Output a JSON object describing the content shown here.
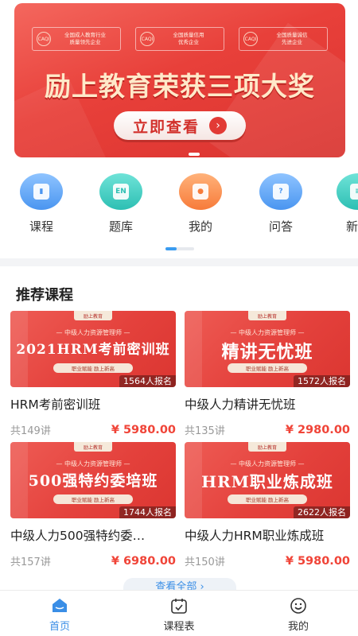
{
  "banner": {
    "awards": [
      {
        "seal": "CAQI",
        "line1": "全国成人教育行业",
        "line2": "质量领先企业"
      },
      {
        "seal": "CAQI",
        "line1": "全国质量信用",
        "line2": "优秀企业"
      },
      {
        "seal": "CAQI",
        "line1": "全国质量诚信",
        "line2": "先进企业"
      }
    ],
    "headline": "励上教育荣获三项大奖",
    "cta_label": "立即查看",
    "cta_arrow": "›"
  },
  "shortcuts": [
    {
      "label": "课程",
      "icon": "book-icon",
      "glyph": "▮",
      "color_from": "#8fc4ff",
      "color_to": "#4a95f0"
    },
    {
      "label": "题库",
      "icon": "question-bank-icon",
      "glyph": "EN",
      "color_from": "#6fe3d8",
      "color_to": "#2dbfb3"
    },
    {
      "label": "我的",
      "icon": "user-icon",
      "glyph": "●",
      "color_from": "#ffb27a",
      "color_to": "#f77b3a"
    },
    {
      "label": "问答",
      "icon": "qa-icon",
      "glyph": "?",
      "color_from": "#8fc4ff",
      "color_to": "#4a95f0"
    },
    {
      "label": "新闻",
      "icon": "news-icon",
      "glyph": "≡",
      "color_from": "#6fe3d8",
      "color_to": "#2dbfb3"
    }
  ],
  "section_title": "推荐课程",
  "courses": [
    {
      "thumb_sub": "— 中级人力资源管理师 —",
      "thumb_title": "2021HRM考前密训班",
      "thumb_pill": "职业赋能 励上新高",
      "logo": "励上教育",
      "enroll": "1564人报名",
      "title": "HRM考前密训班",
      "lessons": "共149讲",
      "price": "¥ 5980.00"
    },
    {
      "thumb_sub": "— 中级人力资源管理师 —",
      "thumb_title": "精讲无忧班",
      "thumb_pill": "职业赋能 励上新高",
      "logo": "励上教育",
      "enroll": "1572人报名",
      "title": "中级人力精讲无忧班",
      "lessons": "共135讲",
      "price": "¥ 2980.00"
    },
    {
      "thumb_sub": "— 中级人力资源管理师 —",
      "thumb_title": "500强特约委培班",
      "thumb_pill": "职业赋能 励上新高",
      "logo": "励上教育",
      "enroll": "1744人报名",
      "title": "中级人力500强特约委…",
      "lessons": "共157讲",
      "price": "¥ 6980.00"
    },
    {
      "thumb_sub": "— 中级人力资源管理师 —",
      "thumb_title": "HRM职业炼成班",
      "thumb_pill": "职业赋能 励上新高",
      "logo": "励上教育",
      "enroll": "2622人报名",
      "title": "中级人力HRM职业炼成班",
      "lessons": "共150讲",
      "price": "¥ 5980.00"
    }
  ],
  "view_all": "查看全部 ›",
  "tabs": [
    {
      "label": "首页",
      "icon": "home-icon",
      "active": true
    },
    {
      "label": "课程表",
      "icon": "calendar-icon",
      "active": false
    },
    {
      "label": "我的",
      "icon": "smiley-icon",
      "active": false
    }
  ],
  "colors": {
    "accent": "#3a8ee6",
    "price": "#f04438",
    "banner_red": "#e23a35"
  }
}
